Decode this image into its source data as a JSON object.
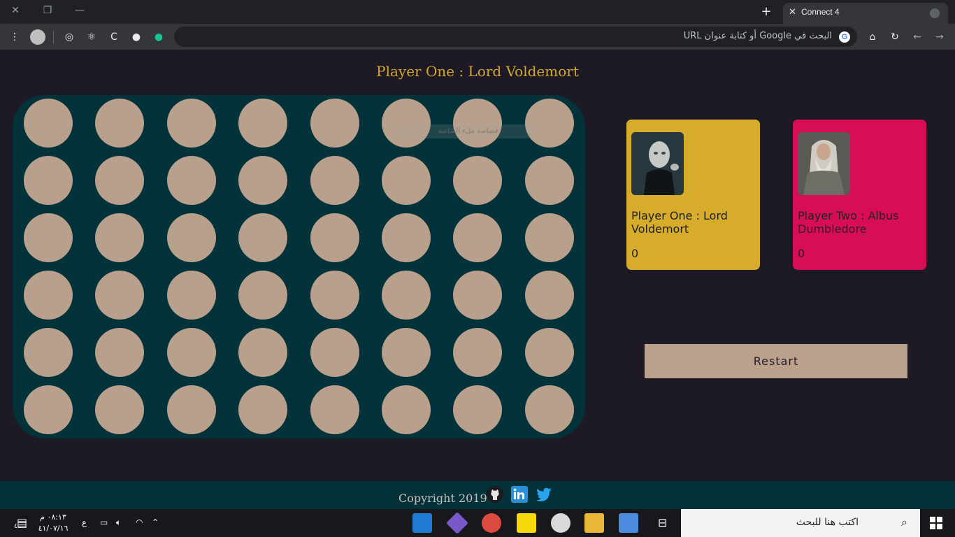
{
  "browser": {
    "tab_title": "Connect 4",
    "omnibox_placeholder": "البحث في Google أو كتابة عنوان URL",
    "google_letter": "G"
  },
  "game": {
    "turn_text": "Player One : Lord Voldemort",
    "board": {
      "rows": 6,
      "columns": 8,
      "empty_color": "#b9a08c",
      "board_color": "#04323a"
    },
    "overlay_tip": "قصاصة ملء الشاشة",
    "player_one": {
      "name": "Player One : Lord Voldemort",
      "score": "0",
      "color": "#d6ac2a"
    },
    "player_two": {
      "name": "Player Two : Albus Dumbledore",
      "score": "0",
      "color": "#d70e55"
    },
    "restart_label": "Restart"
  },
  "footer": {
    "copyright": "Copyright 2019",
    "social_icons": [
      "github-icon",
      "linkedin-icon",
      "twitter-icon"
    ]
  },
  "taskbar": {
    "search_placeholder": "اكتب هنا للبحث",
    "time": "٠٨:١٣ م",
    "date": "٤١/٠٧/١٦",
    "notification_count": "٤",
    "lang": "ع"
  }
}
